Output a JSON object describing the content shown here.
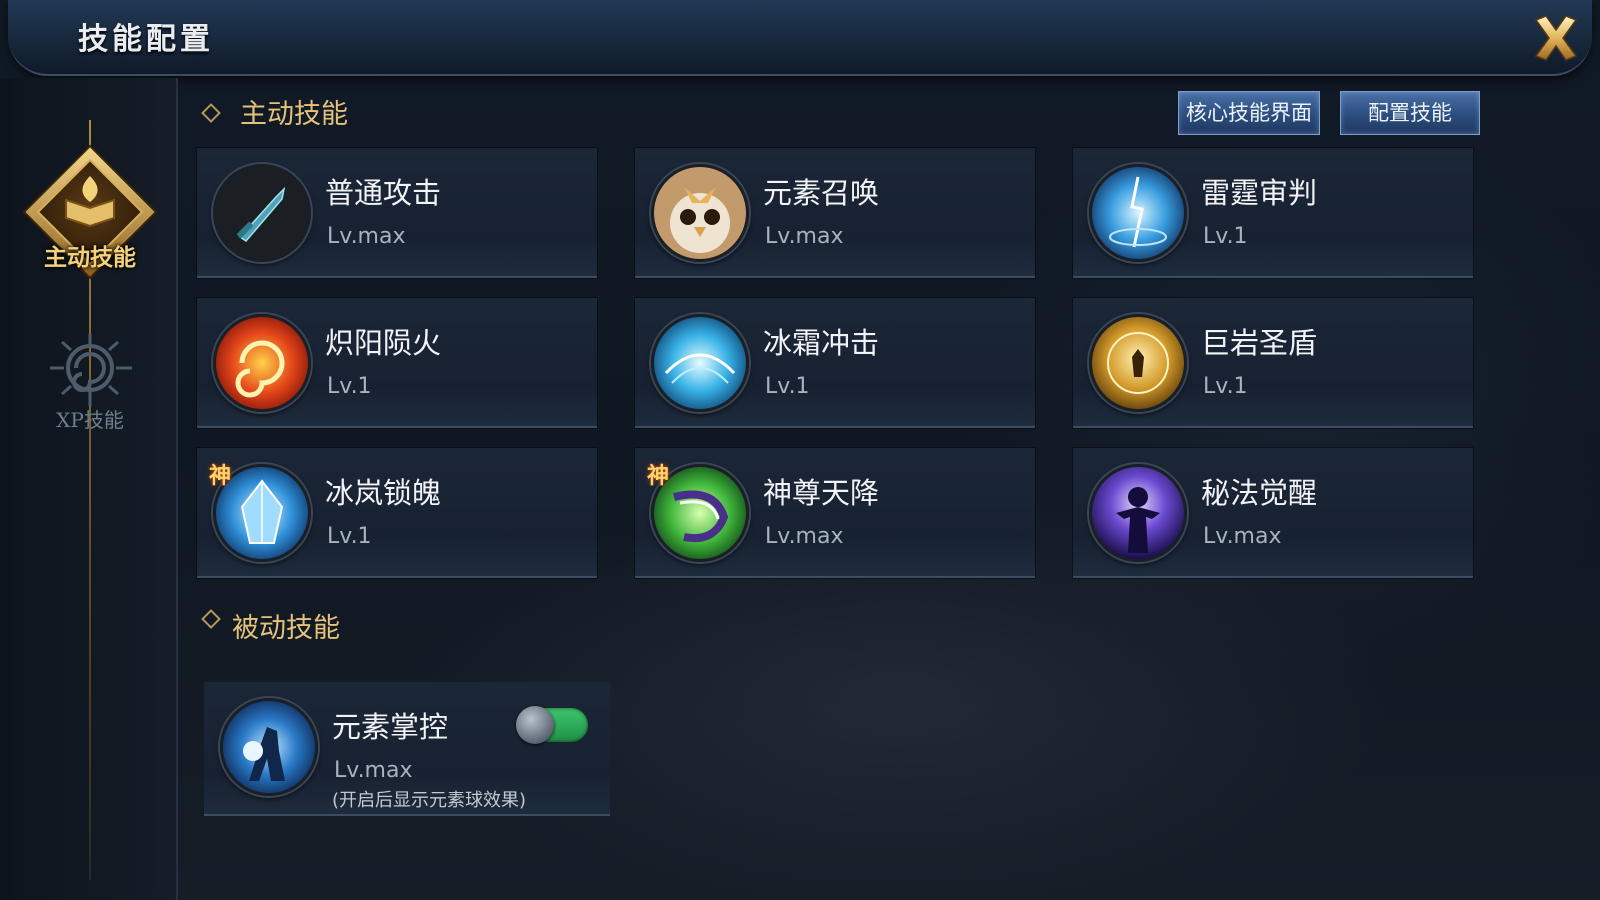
{
  "window": {
    "title": "技能配置",
    "close_icon": "close-x-icon"
  },
  "sidebar": {
    "tabs": [
      {
        "label": "主动技能",
        "active": true,
        "icon": "book-flame-emblem-icon"
      },
      {
        "label": "XP技能",
        "active": false,
        "icon": "spiral-emblem-icon"
      }
    ]
  },
  "active_section": {
    "title": "主动技能",
    "buttons": {
      "core": "核心技能界面",
      "configure": "配置技能"
    },
    "skills": [
      {
        "name": "普通攻击",
        "level": "Lv.max",
        "icon": "sword-icon"
      },
      {
        "name": "元素召唤",
        "level": "Lv.max",
        "icon": "owl-spirit-icon"
      },
      {
        "name": "雷霆审判",
        "level": "Lv.1",
        "icon": "lightning-orb-icon"
      },
      {
        "name": "炽阳陨火",
        "level": "Lv.1",
        "icon": "fire-swirl-icon"
      },
      {
        "name": "冰霜冲击",
        "level": "Lv.1",
        "icon": "ice-blast-icon"
      },
      {
        "name": "巨岩圣盾",
        "level": "Lv.1",
        "icon": "golden-shield-orb-icon"
      },
      {
        "name": "冰岚锁魄",
        "level": "Lv.1",
        "icon": "ice-crystal-icon",
        "badge": "神"
      },
      {
        "name": "神尊天降",
        "level": "Lv.max",
        "icon": "green-vortex-icon",
        "badge": "神"
      },
      {
        "name": "秘法觉醒",
        "level": "Lv.max",
        "icon": "arcane-figure-icon"
      }
    ]
  },
  "passive_section": {
    "title": "被动技能",
    "skill": {
      "name": "元素掌控",
      "level": "Lv.max",
      "note": "(开启后显示元素球效果)",
      "icon": "element-mastery-icon",
      "toggle_on": true
    }
  },
  "colors": {
    "accent_gold": "#e4c27a",
    "toggle_on": "#3ec76d",
    "button_blue": "#2b4d7f"
  }
}
